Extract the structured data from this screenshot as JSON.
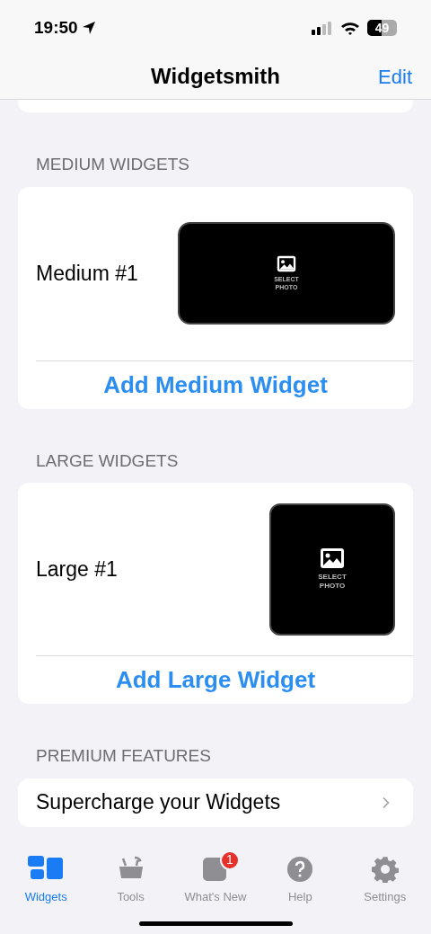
{
  "status_bar": {
    "time": "19:50",
    "battery": "49"
  },
  "nav": {
    "title": "Widgetsmith",
    "action": "Edit"
  },
  "sections": [
    {
      "header": "MEDIUM WIDGETS",
      "widgets": [
        {
          "name": "Medium #1",
          "kind": "medium",
          "preview_label": "SELECT\nPHOTO"
        }
      ],
      "add_button": "Add Medium Widget"
    },
    {
      "header": "LARGE WIDGETS",
      "widgets": [
        {
          "name": "Large #1",
          "kind": "large",
          "preview_label": "SELECT\nPHOTO"
        }
      ],
      "add_button": "Add Large Widget"
    }
  ],
  "premium": {
    "header": "PREMIUM FEATURES",
    "row": "Supercharge your Widgets"
  },
  "tabs": [
    {
      "label": "Widgets",
      "kind": "widgets",
      "selected": true
    },
    {
      "label": "Tools",
      "kind": "tools",
      "selected": false
    },
    {
      "label": "What's New",
      "kind": "news",
      "selected": false,
      "badge": "1"
    },
    {
      "label": "Help",
      "kind": "help",
      "selected": false
    },
    {
      "label": "Settings",
      "kind": "settings",
      "selected": false
    }
  ]
}
